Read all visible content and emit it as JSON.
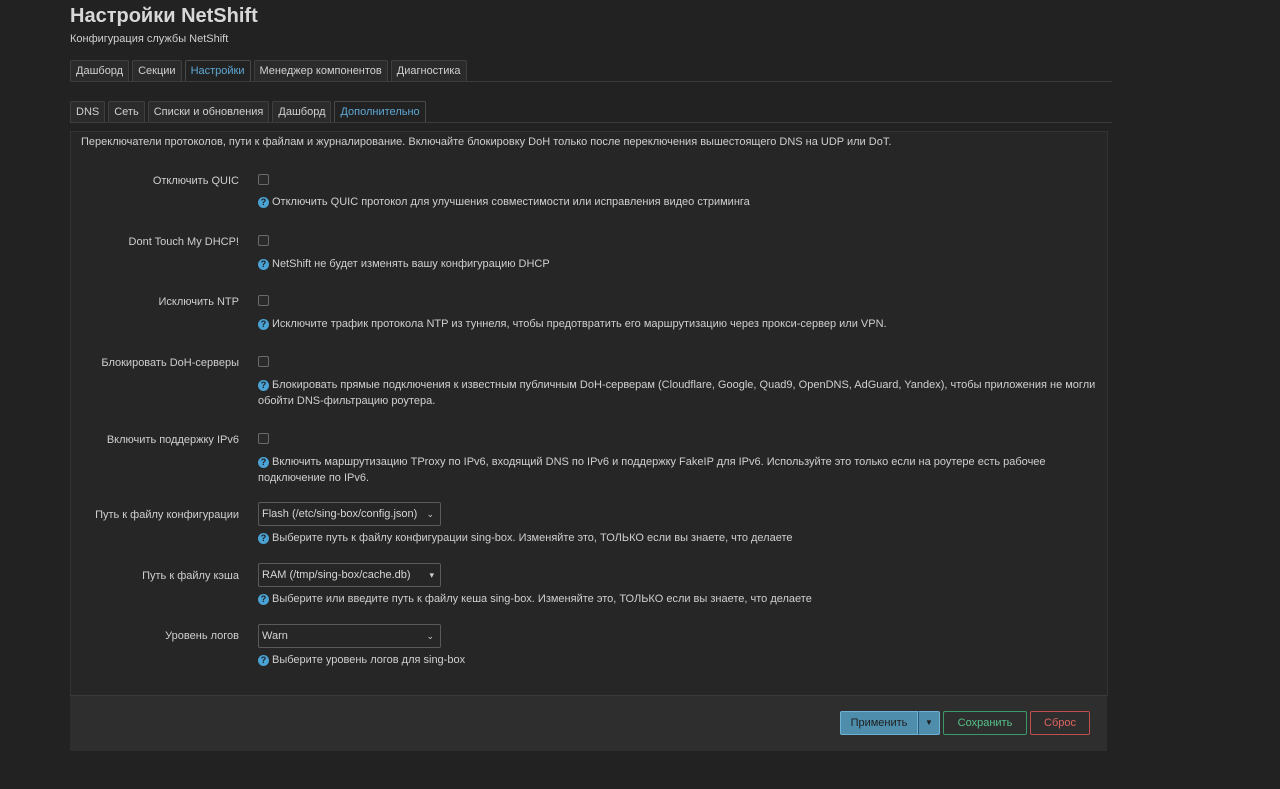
{
  "header": {
    "title": "Настройки NetShift",
    "subtitle": "Конфигурация службы NetShift"
  },
  "main_tabs": [
    {
      "label": "Дашборд",
      "active": false
    },
    {
      "label": "Секции",
      "active": false
    },
    {
      "label": "Настройки",
      "active": true
    },
    {
      "label": "Менеджер компонентов",
      "active": false
    },
    {
      "label": "Диагностика",
      "active": false
    }
  ],
  "sub_tabs": [
    {
      "label": "DNS",
      "active": false
    },
    {
      "label": "Сеть",
      "active": false
    },
    {
      "label": "Списки и обновления",
      "active": false
    },
    {
      "label": "Дашборд",
      "active": false
    },
    {
      "label": "Дополнительно",
      "active": true
    }
  ],
  "section": {
    "description": "Переключатели протоколов, пути к файлам и журналирование. Включайте блокировку DoH только после переключения вышестоящего DNS на UDP или DoT."
  },
  "fields": {
    "quic": {
      "label": "Отключить QUIC",
      "checked": false,
      "help": "Отключить QUIC протокол для улучшения совместимости или исправления видео стриминга"
    },
    "dhcp": {
      "label": "Dont Touch My DHCP!",
      "checked": false,
      "help": "NetShift не будет изменять вашу конфигурацию DHCP"
    },
    "ntp": {
      "label": "Исключить NTP",
      "checked": false,
      "help": "Исключите трафик протокола NTP из туннеля, чтобы предотвратить его маршрутизацию через прокси-сервер или VPN."
    },
    "doh": {
      "label": "Блокировать DoH-серверы",
      "checked": false,
      "help": "Блокировать прямые подключения к известным публичным DoH-серверам (Cloudflare, Google, Quad9, OpenDNS, AdGuard, Yandex), чтобы приложения не могли обойти DNS-фильтрацию роутера."
    },
    "ipv6": {
      "label": "Включить поддержку IPv6",
      "checked": false,
      "help": "Включить маршрутизацию TProxy по IPv6, входящий DNS по IPv6 и поддержку FakeIP для IPv6. Используйте это только если на роутере есть рабочее подключение по IPv6."
    },
    "config_path": {
      "label": "Путь к файлу конфигурации",
      "value": "Flash (/etc/sing-box/config.json)",
      "help": "Выберите путь к файлу конфигурации sing-box. Изменяйте это, ТОЛЬКО если вы знаете, что делаете"
    },
    "cache_path": {
      "label": "Путь к файлу кэша",
      "value": "RAM (/tmp/sing-box/cache.db)",
      "help": "Выберите или введите путь к файлу кеша sing-box. Изменяйте это, ТОЛЬКО если вы знаете, что делаете"
    },
    "log_level": {
      "label": "Уровень логов",
      "value": "Warn",
      "help": "Выберите уровень логов для sing-box"
    }
  },
  "footer": {
    "apply_label": "Применить",
    "save_label": "Сохранить",
    "reset_label": "Сброс"
  },
  "icons": {
    "help": "question-circle-icon",
    "dropdown": "chevron-down-icon"
  },
  "colors": {
    "background": "#222222",
    "accent": "#4aa3d4",
    "apply": "#4e8dab",
    "save": "#56c18a",
    "reset": "#e06560"
  }
}
